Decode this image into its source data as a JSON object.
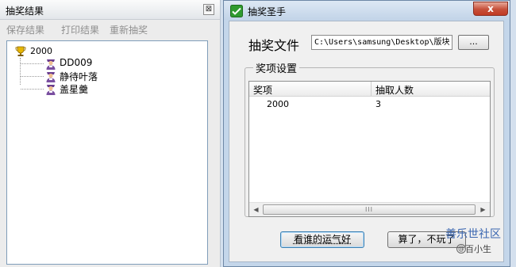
{
  "left_panel": {
    "title": "抽奖结果",
    "close_glyph": "⊠",
    "toolbar": [
      "保存结果",
      "打印结果",
      "重新抽奖"
    ],
    "tree": {
      "root": "2000",
      "root_icon": "trophy-icon",
      "children": [
        {
          "label": "DD009",
          "icon": "person-icon"
        },
        {
          "label": "静待叶落",
          "icon": "person-icon"
        },
        {
          "label": "盖星羹",
          "icon": "person-icon"
        }
      ]
    }
  },
  "dialog": {
    "title": "抽奖圣手",
    "app_icon": "app-logo-icon",
    "close_glyph": "x",
    "file_label": "抽奖文件",
    "file_path": "C:\\Users\\samsung\\Desktop\\版块",
    "browse_label": "...",
    "group_title": "奖项设置",
    "columns": [
      "奖项",
      "抽取人数"
    ],
    "rows": [
      {
        "prize": "2000",
        "count": "3"
      }
    ],
    "scroll_thumb_glyph": "III",
    "buttons": {
      "lucky": "看谁的运气好",
      "forget": "算了，不玩了"
    }
  },
  "watermark": {
    "forum": "善乐世社区",
    "user": "百小生"
  }
}
